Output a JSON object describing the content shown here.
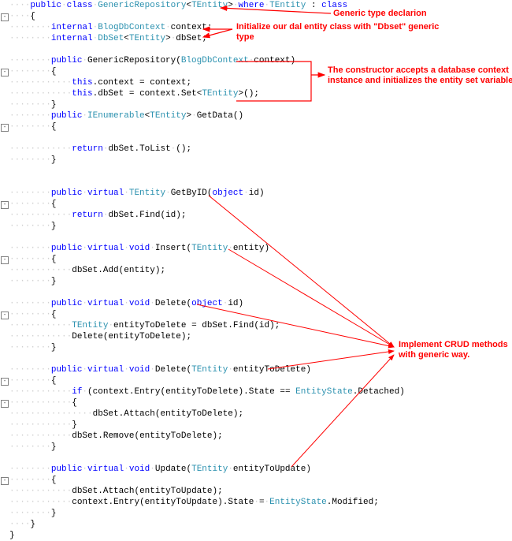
{
  "annotations": {
    "a1": "Generic type declarion",
    "a2_l1": "Initialize our dal entity class with \"Dbset\" generic",
    "a2_l2": "type",
    "a3_l1": "The constructor accepts a database context",
    "a3_l2": "instance and initializes the entity set variable",
    "a4_l1": "Implement CRUD methods",
    "a4_l2": "with generic way."
  },
  "tokens": {
    "public": "public",
    "class": "class",
    "internal": "internal",
    "where": "where",
    "this": "this",
    "return": "return",
    "virtual": "virtual",
    "void": "void",
    "object": "object",
    "if": "if",
    "GenericRepository": "GenericRepository",
    "TEntity": "TEntity",
    "BlogDbContext": "BlogDbContext",
    "DbSet": "DbSet",
    "IEnumerable": "IEnumerable",
    "EntityState": "EntityState",
    "context": "context",
    "dbSet": "dbSet",
    "Set": "Set",
    "GetData": "GetData",
    "ToList": "ToList",
    "GetByID": "GetByID",
    "id": "id",
    "Find": "Find",
    "Insert": "Insert",
    "entity": "entity",
    "Add": "Add",
    "Delete": "Delete",
    "entityToDelete": "entityToDelete",
    "Entry": "Entry",
    "State": "State",
    "Detached": "Detached",
    "Attach": "Attach",
    "Remove": "Remove",
    "Update": "Update",
    "entityToUpdate": "entityToUpdate",
    "Modified": "Modified"
  },
  "sym": {
    "lt": "<",
    "gt": ">",
    "ob": "{",
    "cb": "}",
    "op": "(",
    "cp": ")",
    "sc": ";",
    "eq": " = ",
    "eqeq": " == ",
    "dot": ".",
    "sp": " ",
    "col": " : ",
    "com": ","
  }
}
